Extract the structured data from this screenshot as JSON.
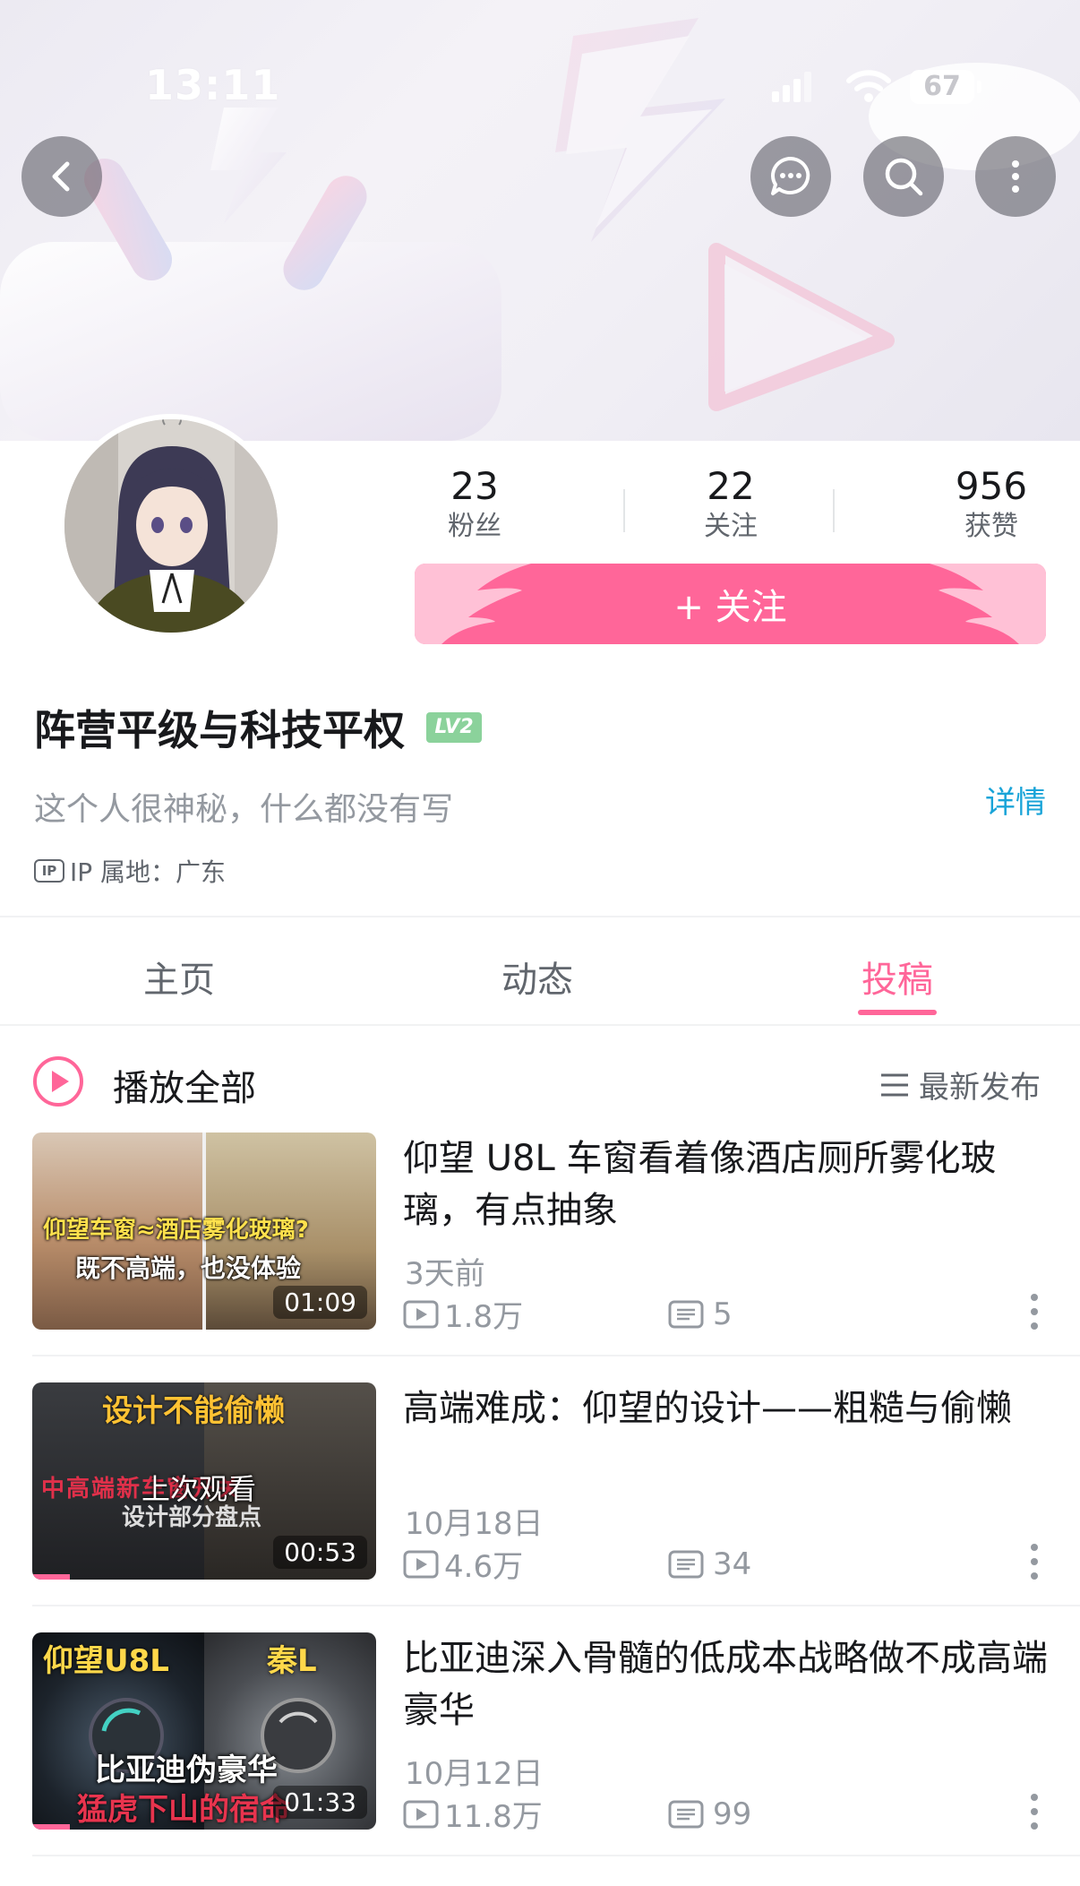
{
  "status_bar": {
    "time": "13:11",
    "battery": "67"
  },
  "header": {
    "icons": [
      "back-icon",
      "message-icon",
      "search-icon",
      "more-icon"
    ]
  },
  "profile": {
    "stats": [
      {
        "value": "23",
        "label": "粉丝"
      },
      {
        "value": "22",
        "label": "关注"
      },
      {
        "value": "956",
        "label": "获赞"
      }
    ],
    "follow_label": "+ 关注",
    "username": "阵营平级与科技平权",
    "level": "LV2",
    "bio": "这个人很神秘，什么都没有写",
    "detail_link": "详情",
    "ip_badge": "IP",
    "ip_location": "IP 属地：广东"
  },
  "tabs": [
    {
      "label": "主页",
      "active": false
    },
    {
      "label": "动态",
      "active": false
    },
    {
      "label": "投稿",
      "active": true
    }
  ],
  "list_header": {
    "play_all": "播放全部",
    "sort": "最新发布"
  },
  "videos": [
    {
      "title": "仰望 U8L 车窗看着像酒店厕所雾化玻璃，有点抽象",
      "date": "3天前",
      "views": "1.8万",
      "danmaku": "5",
      "duration": "01:09",
      "thumb_text_1": "仰望车窗≈酒店雾化玻璃?",
      "thumb_text_2": "既不高端，也没体验",
      "watched": false
    },
    {
      "title": "高端难成：仰望的设计——粗糙与偷懒",
      "date": "10月18日",
      "views": "4.6万",
      "danmaku": "34",
      "duration": "00:53",
      "thumb_text_1": "设计不能偷懒",
      "thumb_text_2": "中高端新车窗开关",
      "thumb_text_3": "设计部分盘点",
      "thumb_overlay": "上次观看",
      "watched": true
    },
    {
      "title": "比亚迪深入骨髓的低成本战略做不成高端豪华",
      "date": "10月12日",
      "views": "11.8万",
      "danmaku": "99",
      "duration": "01:33",
      "thumb_text_1": "仰望U8L",
      "thumb_text_2": "秦L",
      "thumb_text_3": "比亚迪伪豪华",
      "thumb_text_4": "猛虎下山的宿命",
      "watched": true
    }
  ],
  "colors": {
    "accent": "#ff6699",
    "link": "#1aa4d8",
    "level_badge": "#8bd29b",
    "secondary_text": "#9499a0"
  }
}
